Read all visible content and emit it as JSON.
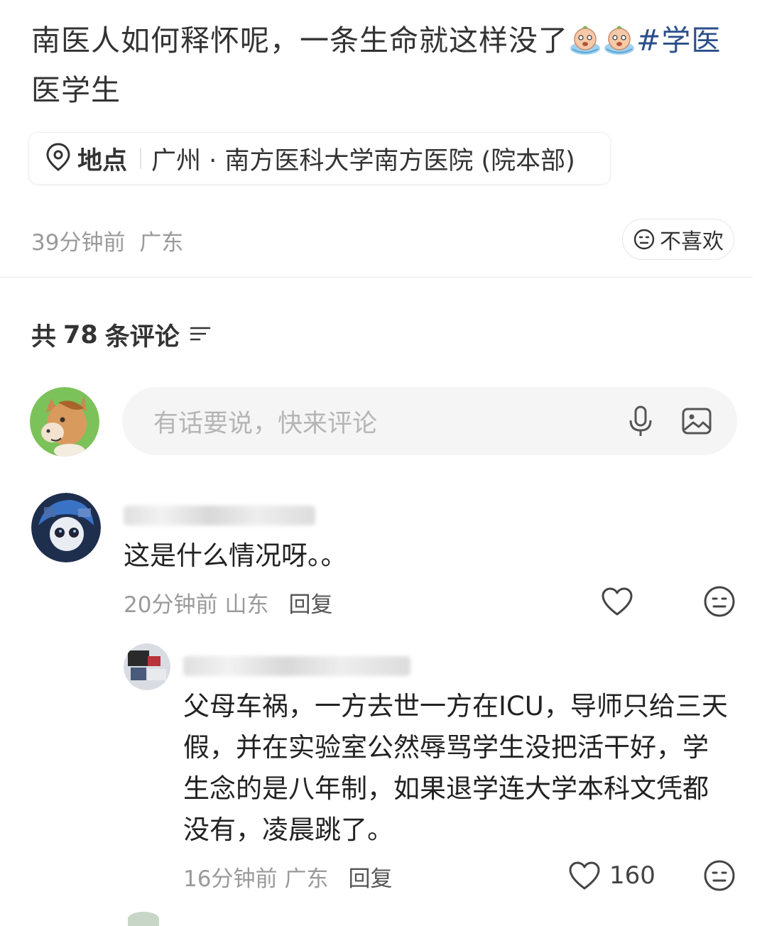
{
  "post": {
    "title_text": "南医人如何释怀呢，一条生命就这样没了",
    "title_hashtag": "#学医",
    "title_line2": "医学生",
    "location_label": "地点",
    "location_value": "广州 · 南方医科大学南方医院 (院本部)",
    "time": "39分钟前",
    "region": "广东",
    "dislike_label": "不喜欢"
  },
  "comments_header": {
    "prefix": "共",
    "count": "78",
    "suffix": "条评论"
  },
  "comment_input": {
    "placeholder": "有话要说，快来评论"
  },
  "comments": [
    {
      "text": "这是什么情况呀。。",
      "time": "20分钟前",
      "region": "山东",
      "reply_label": "回复"
    }
  ],
  "replies": [
    {
      "text_line1": "父母车祸，一方去世一方在ICU，导师只给三天",
      "text_line2": "假，并在实验室公然辱骂学生没把活干好，学",
      "text_line3": "生念的是八年制，如果退学连大学本科文凭都",
      "text_line4": "没有，凌晨跳了。",
      "time": "16分钟前",
      "region": "广东",
      "reply_label": "回复",
      "like_count": "160"
    }
  ],
  "colors": {
    "hashtag": "#2b4f8a",
    "secondary_text": "#9a9a9a",
    "input_bg": "#f5f5f5"
  }
}
